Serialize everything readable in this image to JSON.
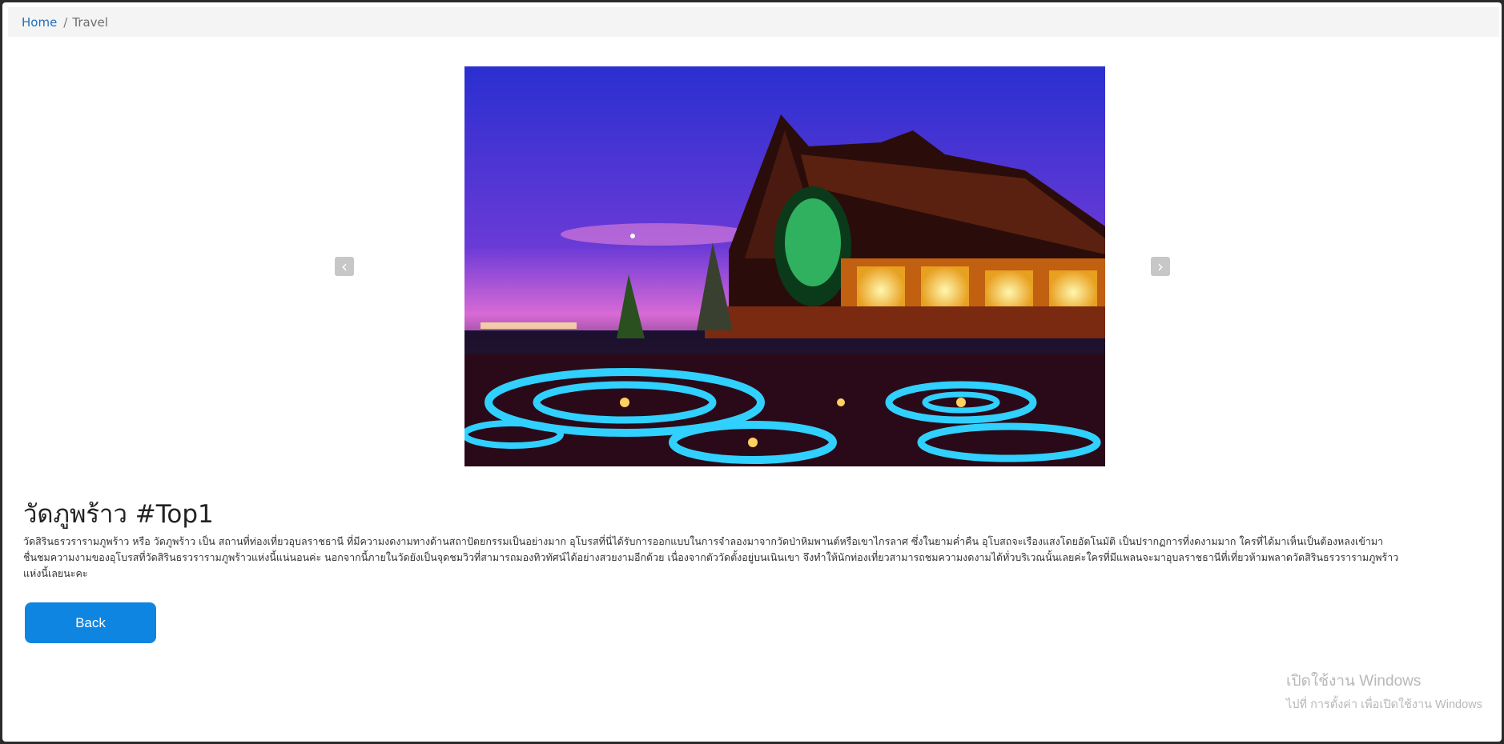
{
  "breadcrumb": {
    "home": "Home",
    "separator": "/",
    "current": "Travel"
  },
  "carousel": {
    "prev_icon": "chevron-left-icon",
    "next_icon": "chevron-right-icon",
    "prev_glyph": "‹",
    "next_glyph": "›"
  },
  "article": {
    "title": "วัดภูพร้าว #Top1",
    "description": "วัดสิรินธรวรารามภูพร้าว หรือ วัดภูพร้าว เป็น สถานที่ท่องเที่ยวอุบลราชธานี ที่มีความงดงามทางด้านสถาปัตยกรรมเป็นอย่างมาก อุโบรสที่นี่ได้รับการออกแบบในการจำลองมาจากวัดป่าหิมพานต์หรือเขาไกรลาศ ซึ่งในยามค่ำคืน อุโบสถจะเรืองแสงโดยอัตโนมัติ เป็นปรากฏการที่งดงามมาก ใครที่ได้มาเห็นเป็นต้องหลงเข้ามาชื่นชมความงามของอุโบรสที่วัดสิรินธรวรารามภูพร้าวแห่งนี้แน่นอนค่ะ นอกจากนี้ภายในวัดยังเป็นจุดชมวิวที่สามารถมองทิวทัศน์ได้อย่างสวยงามอีกด้วย เนื่องจากตัววัดตั้งอยู่บนเนินเขา จึงทำให้นักท่องเที่ยวสามารถชมความงดงามได้ทั่วบริเวณนั้นเลยค่ะใครที่มีแพลนจะมาอุบลราชธานีที่เที่ยวห้ามพลาดวัดสิรินธรวรารามภูพร้าว แห่งนี้เลยนะคะ"
  },
  "actions": {
    "back_label": "Back"
  },
  "watermark": {
    "line1": "เปิดใช้งาน Windows",
    "line2": "ไปที่ การตั้งค่า เพื่อเปิดใช้งาน Windows"
  },
  "colors": {
    "accent": "#0f85e2",
    "link": "#1e6fbd",
    "breadcrumb_bg": "#f4f4f4"
  }
}
